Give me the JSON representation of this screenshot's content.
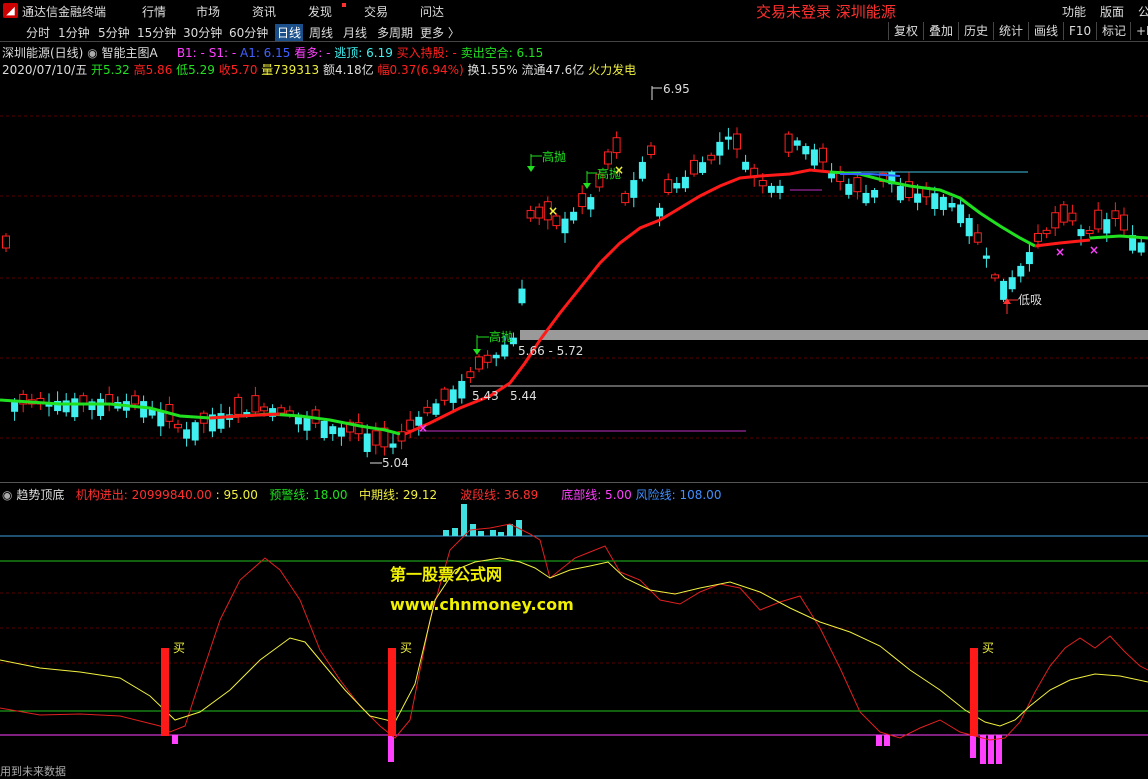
{
  "menu": {
    "app_title": "通达信金融终端",
    "items": [
      "行情",
      "市场",
      "资讯",
      "发现",
      "交易",
      "问达"
    ],
    "status": "交易未登录  深圳能源",
    "right_items": [
      "功能",
      "版面",
      "公"
    ]
  },
  "periods": {
    "items": [
      "分时",
      "1分钟",
      "5分钟",
      "15分钟",
      "30分钟",
      "60分钟",
      "日线",
      "周线",
      "月线",
      "多周期",
      "更多 〉"
    ],
    "active": "日线",
    "tools": [
      "复权",
      "叠加",
      "历史",
      "统计",
      "画线",
      "F10",
      "标记",
      "+B"
    ]
  },
  "main_info": {
    "stock": "深圳能源(日线)",
    "indicator": "智能主图A",
    "b1": "B1: -",
    "s1": "S1: -",
    "a1": "A1: 6.15",
    "kanduo": "看多: -",
    "taoding": "逃顶: 6.19",
    "mairu": "买入持股: -",
    "maichu": "卖出空合: 6.15"
  },
  "quote": {
    "date": "2020/07/10/五",
    "open": "开5.32",
    "high": "高5.86",
    "low": "低5.29",
    "close": "收5.70",
    "volume": "量739313",
    "amount": "额4.18亿",
    "change": "幅0.37(6.94%)",
    "turnover": "换1.55%",
    "float": "流通47.6亿",
    "sector": "火力发电"
  },
  "annotations": {
    "high_sell": "高抛",
    "low_buy": "低吸",
    "peak": "6.95",
    "trough": "5.04",
    "range1": "5.66 - 5.72",
    "range2_a": "5.43",
    "range2_b": "5.44"
  },
  "sub_info": {
    "name": "趋势顶底",
    "jigou": "机构进出: 20999840.00",
    "v95": ": 95.00",
    "yujing": "预警线: 18.00",
    "zhongqi": "中期线: 29.12",
    "bodong": "波段线: 36.89",
    "diji": "底部线: 5.00",
    "fengxian": "风险线: 108.00",
    "buy_label": "买"
  },
  "watermark": {
    "line1": "第一股票公式网",
    "line2": "www.chnmoney.com"
  },
  "footer": "用到未来数据",
  "colors": {
    "up": "#ff2020",
    "down": "#40f0f0",
    "ma_red": "#ff1a1a",
    "ma_green": "#20e020",
    "yellow": "#f0f040",
    "magenta": "#ff40ff"
  }
}
